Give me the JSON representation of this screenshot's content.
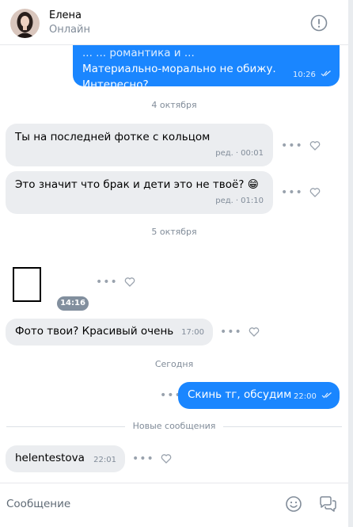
{
  "header": {
    "name": "Елена",
    "status": "Онлайн",
    "avatar_icon": "user-photo",
    "info_icon": "info-circle-icon"
  },
  "messages": {
    "m0": {
      "text_line2": "Материально-морально не обижу.",
      "text_line3": "Интересно?",
      "time": "10:26",
      "truncated_line1": "... ... романтика и ..."
    },
    "date1": "4 октября",
    "m1": {
      "text": "Ты на последней фотке с кольцом",
      "edited": "ред.",
      "time": "00:01"
    },
    "m2": {
      "text": "Это значит что брак и дети это не твоё? 😁",
      "edited": "ред.",
      "time": "01:10"
    },
    "date2": "5 октября",
    "m3": {
      "time": "14:16"
    },
    "m4": {
      "text": "Фото твои? Красивый очень",
      "time": "17:00"
    },
    "date3": "Сегодня",
    "m5": {
      "text": "Скинь тг, обсудим",
      "time": "22:00"
    },
    "new_messages_label": "Новые сообщения",
    "m6": {
      "text": "helentestova",
      "time": "22:01"
    },
    "more_symbol": "•••"
  },
  "composer": {
    "placeholder": "Сообщение",
    "value": ""
  },
  "colors": {
    "outgoing": "#1a86ff",
    "incoming": "#ebedf0",
    "secondary_text": "#818c99"
  }
}
